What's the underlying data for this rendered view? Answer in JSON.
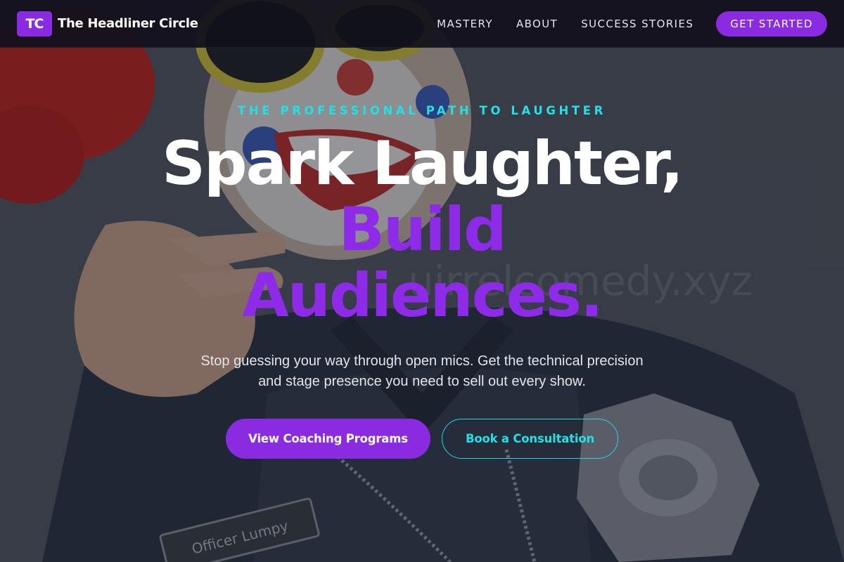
{
  "brand": {
    "badge": "TC",
    "name": "The Headliner Circle",
    "accent_color": "#8a2be2",
    "highlight_color": "#22e0e6"
  },
  "nav": {
    "links": [
      "MASTERY",
      "ABOUT",
      "SUCCESS STORIES"
    ],
    "cta": "GET STARTED"
  },
  "hero": {
    "eyebrow": "THE PROFESSIONAL PATH TO LAUGHTER",
    "headline_line1": "Spark Laughter,",
    "headline_line2": "Build",
    "headline_line3": "Audiences.",
    "subtext": "Stop guessing your way through open mics. Get the technical precision and stage presence you need to sell out every show.",
    "primary_button": "View Coaching Programs",
    "secondary_button": "Book a Consultation",
    "background_image": "clown-police-officer-photo",
    "nametag_text": "Officer Lumpy"
  }
}
